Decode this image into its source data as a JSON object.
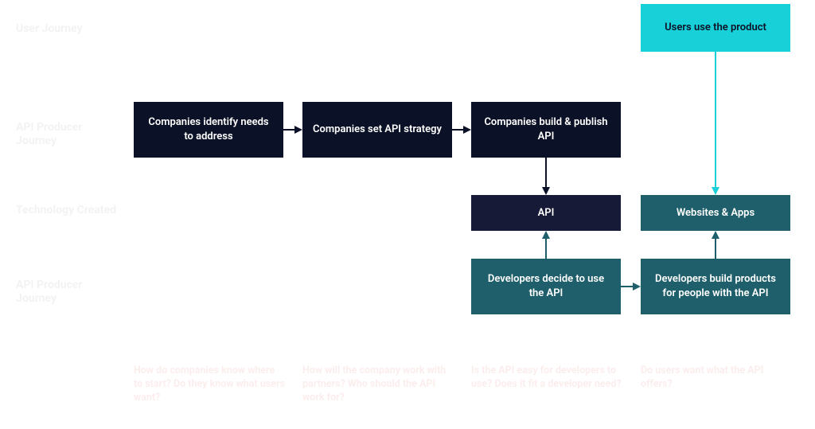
{
  "rowLabels": {
    "user": "User Journey",
    "apiProducer": "API Producer Journey",
    "tech": "Technology Created",
    "apiConsumer": "API Producer Journey"
  },
  "boxes": {
    "usersUse": "Users use the product",
    "identify": "Companies identify needs to address",
    "strategy": "Companies set API strategy",
    "buildPublish": "Companies build & publish API",
    "api": "API",
    "websitesApps": "Websites & Apps",
    "devDecide": "Developers decide to use the API",
    "devBuild": "Developers build products for people with the API"
  },
  "questions": {
    "q1": "How do companies know where to start? Do they know what users want?",
    "q2": "How will the company work with partners? Who should the API work for?",
    "q3": "Is the API easy for developers to use? Does it fit a developer need?",
    "q4": "Do users want what the API offers?"
  },
  "colors": {
    "dark": "#0b1126",
    "darkb": "#161a36",
    "teal": "#1f5f6b",
    "cyan": "#18d0d8",
    "questionRed": "rgba(223,30,30,0.08)"
  }
}
